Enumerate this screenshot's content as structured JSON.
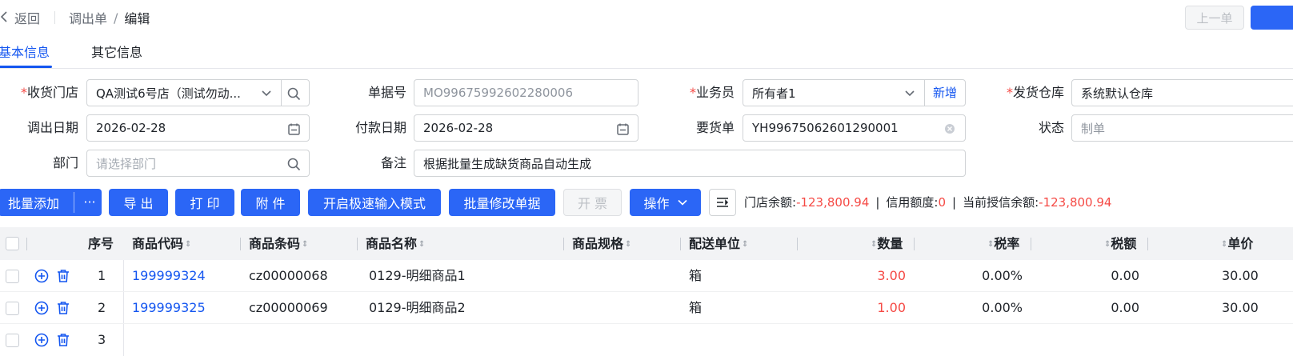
{
  "nav": {
    "back_label": "返回",
    "breadcrumb_parent": "调出单",
    "breadcrumb_current": "编辑",
    "prev_label": "上一单"
  },
  "tabs": [
    {
      "label": "基本信息",
      "active": true
    },
    {
      "label": "其它信息",
      "active": false
    }
  ],
  "form": {
    "receive_store": {
      "label": "收货门店",
      "required": true,
      "value": "QA测试6号店（测试勿动..."
    },
    "doc_no": {
      "label": "单据号",
      "value": "MO99675992602280006"
    },
    "salesman": {
      "label": "业务员",
      "required": true,
      "value": "所有者1",
      "add_label": "新增"
    },
    "ship_warehouse": {
      "label": "发货仓库",
      "required": true,
      "value": "系统默认仓库"
    },
    "out_date": {
      "label": "调出日期",
      "value": "2026-02-28"
    },
    "pay_date": {
      "label": "付款日期",
      "value": "2026-02-28"
    },
    "request_doc": {
      "label": "要货单",
      "value": "YH99675062601290001"
    },
    "status": {
      "label": "状态",
      "value": "制单"
    },
    "department": {
      "label": "部门",
      "placeholder": "请选择部门"
    },
    "remark": {
      "label": "备注",
      "value": "根据批量生成缺货商品自动生成"
    }
  },
  "toolbar": {
    "batch_add": "批量添加",
    "more": "···",
    "export": "导 出",
    "print": "打 印",
    "attach": "附 件",
    "fast_input": "开启极速输入模式",
    "batch_modify": "批量修改单据",
    "invoice": "开 票",
    "operate": "操作",
    "store_balance_label": "门店余额:",
    "store_balance_value": "-123,800.94",
    "credit_label": "信用额度:",
    "credit_value": "0",
    "credit_balance_label": "当前授信余额:",
    "credit_balance_value": "-123,800.94"
  },
  "colors": {
    "primary": "#2b66f6",
    "link": "#1456f0",
    "danger": "#f54a45"
  },
  "table": {
    "headers": {
      "seq": "序号",
      "code": "商品代码",
      "barcode": "商品条码",
      "name": "商品名称",
      "spec": "商品规格",
      "unit": "配送单位",
      "qty": "数量",
      "tax_rate": "税率",
      "tax_amount": "税额",
      "price": "单价"
    },
    "rows": [
      {
        "seq": "1",
        "code": "199999324",
        "barcode": "cz00000068",
        "name": "0129-明细商品1",
        "unit": "箱",
        "qty": "3.00",
        "tax_rate": "0.00%",
        "tax_amount": "0.00",
        "price": "30.00"
      },
      {
        "seq": "2",
        "code": "199999325",
        "barcode": "cz00000069",
        "name": "0129-明细商品2",
        "unit": "箱",
        "qty": "1.00",
        "tax_rate": "0.00%",
        "tax_amount": "0.00",
        "price": "30.00"
      },
      {
        "seq": "3",
        "code": "",
        "barcode": "",
        "name": "",
        "unit": "",
        "qty": "",
        "tax_rate": "",
        "tax_amount": "",
        "price": ""
      }
    ]
  }
}
